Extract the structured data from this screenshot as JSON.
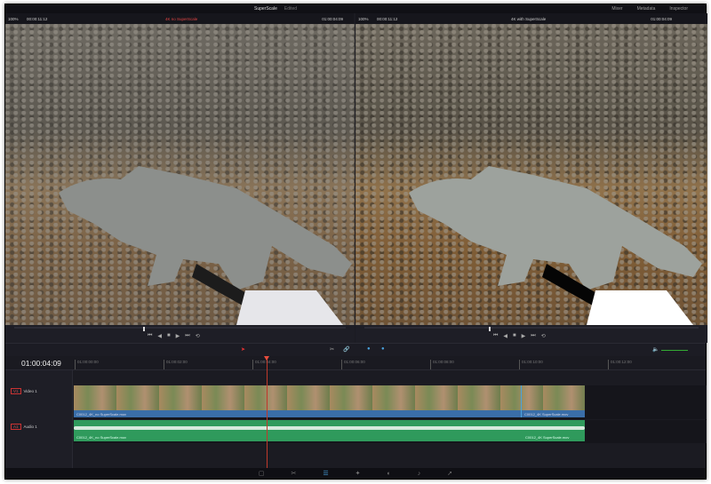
{
  "titlebar": {
    "title": "SuperScale",
    "subtitle": "Edited",
    "buttons": [
      "Mixer",
      "Metadata",
      "Inspector"
    ]
  },
  "left_viewer": {
    "zoom": "100%",
    "timecode": "00:00:11:12",
    "clip_name": "4K no SuperScale",
    "duration": "01:00:04:09"
  },
  "right_viewer": {
    "zoom": "100%",
    "timecode": "00:00:11:12",
    "clip_name": "4K with SuperScale",
    "duration": "01:00:04:09"
  },
  "timeline": {
    "current_timecode": "01:00:04:09",
    "ruler": [
      "01:00:00:00",
      "01:00:02:00",
      "01:00:04:00",
      "01:00:06:00",
      "01:00:08:00",
      "01:00:10:00",
      "01:00:12:00"
    ],
    "tracks": [
      {
        "id": "V1",
        "name": "Video 1"
      },
      {
        "id": "A1",
        "name": "Audio 1"
      }
    ],
    "clips": {
      "video_1": "C0012_4K_no SuperScale.mov",
      "video_2": "C0012_4K SuperScale.mov",
      "audio_1": "C0012_4K_no SuperScale.mov",
      "audio_2": "C0012_4K SuperScale.mov"
    }
  },
  "colors": {
    "accent": "#4aa3df",
    "playhead": "#e74c3c",
    "video_clip": "#3a6ea8",
    "audio_clip": "#2f9a5c"
  },
  "pages": [
    "media-icon",
    "cut-icon",
    "edit-icon",
    "fusion-icon",
    "color-icon",
    "fairlight-icon",
    "deliver-icon"
  ]
}
